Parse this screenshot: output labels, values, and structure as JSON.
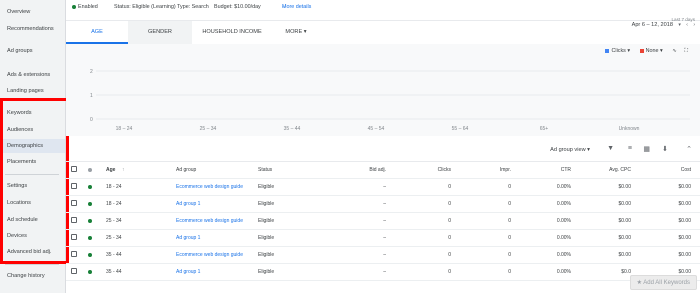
{
  "sidebar": {
    "items": [
      {
        "label": "Overview"
      },
      {
        "label": "Recommendations"
      },
      {
        "label": "Ad groups"
      },
      {
        "label": "Ads & extensions"
      },
      {
        "label": "Landing pages"
      },
      {
        "label": "Keywords"
      },
      {
        "label": "Audiences"
      },
      {
        "label": "Demographics"
      },
      {
        "label": "Placements"
      },
      {
        "label": "Settings"
      },
      {
        "label": "Locations"
      },
      {
        "label": "Ad schedule"
      },
      {
        "label": "Devices"
      },
      {
        "label": "Advanced bid adj."
      },
      {
        "label": "Change history"
      }
    ]
  },
  "status": {
    "enabled": "Enabled",
    "status_text": "Status: Eligible (Learning)",
    "type_text": "Type: Search",
    "budget_text": "Budget: $10.00/day",
    "more_details": "More details"
  },
  "tabs": [
    {
      "label": "AGE"
    },
    {
      "label": "GENDER"
    },
    {
      "label": "HOUSEHOLD INCOME"
    },
    {
      "label": "MORE"
    }
  ],
  "daterange": {
    "caption": "Last 7 days",
    "value": "Apr 6 – 12, 2018"
  },
  "chart": {
    "legend_clicks": "Clicks",
    "legend_none": "None",
    "y_ticks": [
      "2",
      "1",
      "0"
    ],
    "x_labels": [
      "18 – 24",
      "25 – 34",
      "35 – 44",
      "45 – 54",
      "55 – 64",
      "65+",
      "Unknown"
    ],
    "colors": {
      "clicks": "#4285f4",
      "none": "#ea4335"
    }
  },
  "toolbar": {
    "view_label": "Ad group view"
  },
  "table": {
    "headers": [
      "Age",
      "Ad group",
      "Status",
      "Bid adj.",
      "Clicks",
      "Impr.",
      "CTR",
      "Avg. CPC",
      "Cost"
    ],
    "rows": [
      [
        "18 - 24",
        "Ecommerce web design guide",
        "Eligible",
        "–",
        "0",
        "0",
        "0.00%",
        "$0.00",
        "$0.00"
      ],
      [
        "18 - 24",
        "Ad group 1",
        "Eligible",
        "–",
        "0",
        "0",
        "0.00%",
        "$0.00",
        "$0.00"
      ],
      [
        "25 - 34",
        "Ecommerce web design guide",
        "Eligible",
        "–",
        "0",
        "0",
        "0.00%",
        "$0.00",
        "$0.00"
      ],
      [
        "25 - 34",
        "Ad group 1",
        "Eligible",
        "–",
        "0",
        "0",
        "0.00%",
        "$0.00",
        "$0.00"
      ],
      [
        "35 - 44",
        "Ecommerce web design guide",
        "Eligible",
        "–",
        "0",
        "0",
        "0.00%",
        "$0.00",
        "$0.00"
      ],
      [
        "35 - 44",
        "Ad group 1",
        "Eligible",
        "–",
        "0",
        "0",
        "0.00%",
        "$0.0",
        "$0.00"
      ]
    ]
  },
  "add_keywords": "Add All Keywords"
}
